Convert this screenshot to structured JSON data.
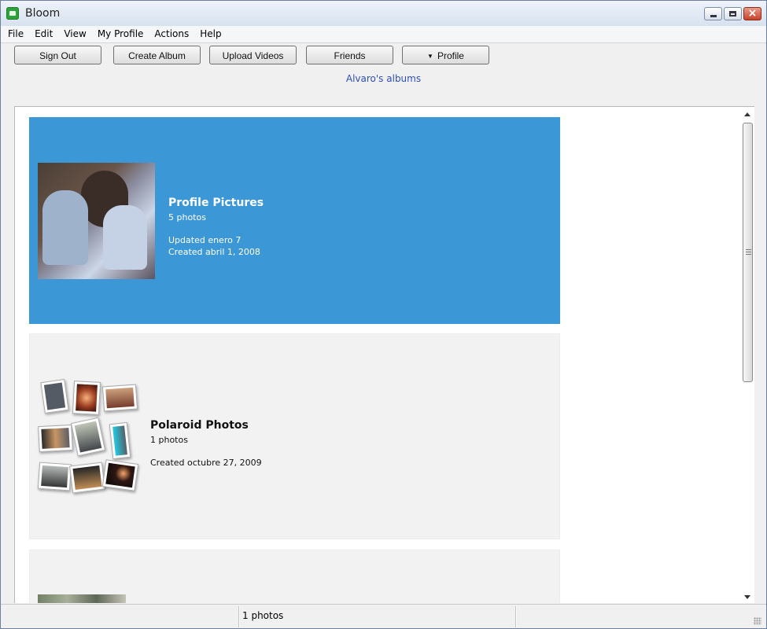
{
  "window": {
    "title": "Bloom"
  },
  "menu": {
    "items": [
      "File",
      "Edit",
      "View",
      "My Profile",
      "Actions",
      "Help"
    ]
  },
  "toolbar": {
    "sign_out": "Sign Out",
    "create_album": "Create Album",
    "upload_videos": "Upload Videos",
    "friends": "Friends",
    "profile": "Profile"
  },
  "page": {
    "heading": "Alvaro's albums"
  },
  "albums": [
    {
      "name": "Profile Pictures",
      "count": "5 photos",
      "updated": "Updated enero 7",
      "created": "Created abril 1, 2008"
    },
    {
      "name": "Polaroid Photos",
      "count": "1 photos",
      "created": "Created octubre 27, 2009"
    }
  ],
  "status": {
    "text": "1 photos"
  },
  "icons": {
    "app": "bloom-app-icon",
    "minimize": "minimize-icon",
    "maximize": "maximize-icon",
    "close": "close-icon",
    "scroll_up": "scroll-up-icon",
    "scroll_down": "scroll-down-icon"
  },
  "colors": {
    "selected_album": "#3c97d6",
    "heading_link": "#2f4fb4",
    "album_background": "#f2f2f2"
  }
}
